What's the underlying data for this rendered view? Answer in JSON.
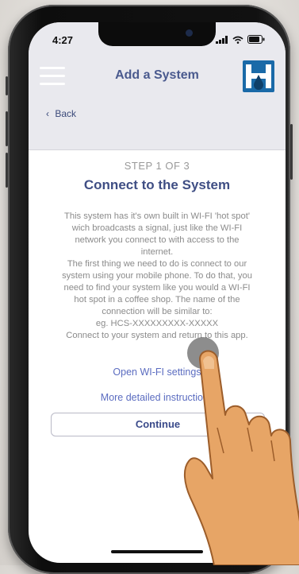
{
  "status_bar": {
    "time": "4:27"
  },
  "header": {
    "title": "Add a System",
    "back_label": "Back"
  },
  "step": {
    "counter": "STEP 1 OF 3",
    "title": "Connect to the System",
    "description_lines": [
      "This system has it's own built in WI-FI 'hot spot'",
      "wich broadcasts a signal, just like the WI-FI",
      "network you connect to with access to the",
      "internet.",
      "The first thing we need to do is connect to our",
      "system using your mobile phone. To do that, you",
      "need to find your system like you would a WI-FI",
      "hot spot in a coffee shop. The name of the",
      "connection will be similar to:",
      "eg. HCS-XXXXXXXXX-XXXXX",
      "Connect to your system and return to this app."
    ]
  },
  "actions": {
    "open_wifi": "Open WI-FI settings",
    "instructions": "More detailed instructions",
    "continue": "Continue"
  },
  "colors": {
    "accent": "#3f4e84",
    "link": "#5b6cc0",
    "header_bg": "#e9e9ee",
    "logo_bg": "#1a6aa8"
  },
  "icons": [
    "menu-icon",
    "logo-icon",
    "chevron-left-icon",
    "signal-icon",
    "wifi-icon",
    "battery-icon",
    "hand-pointer-icon"
  ]
}
